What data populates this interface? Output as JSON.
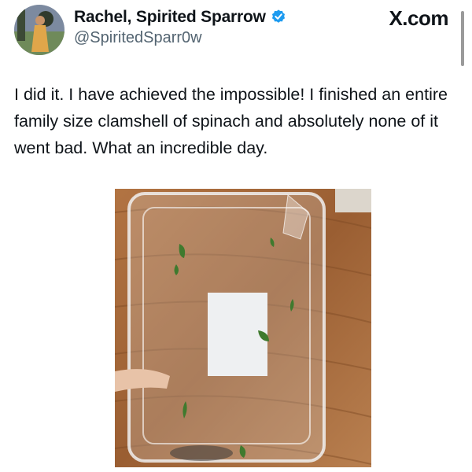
{
  "author": {
    "display_name": "Rachel, Spirited Sparrow",
    "handle": "@SpiritedSparr0w",
    "verified_icon": "verified-badge-icon",
    "avatar_icon": "avatar"
  },
  "site_label": "X.com",
  "post": {
    "text": "I did it. I have achieved the impossible! I finished an entire family size clamshell of spinach and absolutely none of it went bad. What an incredible day."
  },
  "photo": {
    "icon": "empty-spinach-clamshell-photo"
  },
  "colors": {
    "text": "#0f1419",
    "handle": "#536471",
    "verified": "#1d9bf0",
    "wood": "#a86a3a"
  }
}
